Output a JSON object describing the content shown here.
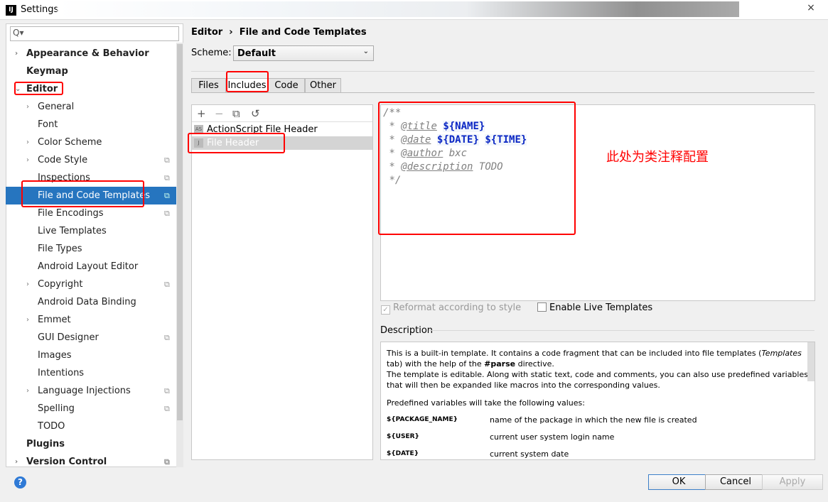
{
  "window": {
    "title": "Settings",
    "close_icon": "×"
  },
  "search": {
    "placeholder": "",
    "icon": "Q▾"
  },
  "sidebar": {
    "items": [
      {
        "label": "Appearance & Behavior",
        "level": 0,
        "bold": true,
        "arrow": "›"
      },
      {
        "label": "Keymap",
        "level": 0,
        "bold": true
      },
      {
        "label": "Editor",
        "level": 0,
        "bold": true,
        "arrow": "⌄"
      },
      {
        "label": "General",
        "level": 1,
        "arrow": "›"
      },
      {
        "label": "Font",
        "level": 1
      },
      {
        "label": "Color Scheme",
        "level": 1,
        "arrow": "›"
      },
      {
        "label": "Code Style",
        "level": 1,
        "arrow": "›",
        "copy": true
      },
      {
        "label": "Inspections",
        "level": 1,
        "copy": true
      },
      {
        "label": "File and Code Templates",
        "level": 1,
        "copy": true,
        "selected": true
      },
      {
        "label": "File Encodings",
        "level": 1,
        "copy": true
      },
      {
        "label": "Live Templates",
        "level": 1
      },
      {
        "label": "File Types",
        "level": 1
      },
      {
        "label": "Android Layout Editor",
        "level": 1
      },
      {
        "label": "Copyright",
        "level": 1,
        "arrow": "›",
        "copy": true
      },
      {
        "label": "Android Data Binding",
        "level": 1
      },
      {
        "label": "Emmet",
        "level": 1,
        "arrow": "›"
      },
      {
        "label": "GUI Designer",
        "level": 1,
        "copy": true
      },
      {
        "label": "Images",
        "level": 1
      },
      {
        "label": "Intentions",
        "level": 1
      },
      {
        "label": "Language Injections",
        "level": 1,
        "arrow": "›",
        "copy": true
      },
      {
        "label": "Spelling",
        "level": 1,
        "copy": true
      },
      {
        "label": "TODO",
        "level": 1
      },
      {
        "label": "Plugins",
        "level": 0,
        "bold": true
      },
      {
        "label": "Version Control",
        "level": 0,
        "bold": true,
        "arrow": "›",
        "copy": true
      }
    ]
  },
  "breadcrumb": {
    "parent": "Editor",
    "sep": "›",
    "current": "File and Code Templates"
  },
  "scheme": {
    "label": "Scheme:",
    "value": "Default"
  },
  "tabs": [
    "Files",
    "Includes",
    "Code",
    "Other"
  ],
  "active_tab": "Includes",
  "toolbar": {
    "add": "+",
    "remove": "−",
    "copy": "⧉",
    "reset": "↺"
  },
  "templates": [
    "ActionScript File Header",
    "File Header"
  ],
  "selected_template": "File Header",
  "editor": {
    "line1": "/**",
    "title_tag": "@title",
    "name_var": "${NAME}",
    "date_tag": "@date",
    "date_var": "${DATE}",
    "time_var": "${TIME}",
    "author_tag": "@author",
    "author": "bxc",
    "desc_tag": "@description",
    "desc": "TODO",
    "end": "*/"
  },
  "annotation": "此处为类注释配置",
  "options": {
    "reformat": "Reformat according to style",
    "reformat_checked": true,
    "live": "Enable Live Templates",
    "live_checked": false
  },
  "description": {
    "label": "Description",
    "p1a": "This is a built-in template. It contains a code fragment that can be included into file templates (",
    "p1b": "Templates",
    "p1c": " tab) with the help of the ",
    "p1d": "#parse",
    "p1e": " directive.",
    "p2": "The template is editable. Along with static text, code and comments, you can also use predefined variables that will then be expanded like macros into the corresponding values.",
    "p3": "Predefined variables will take the following values:",
    "vars": [
      {
        "name": "${PACKAGE_NAME}",
        "desc": "name of the package in which the new file is created"
      },
      {
        "name": "${USER}",
        "desc": "current user system login name"
      },
      {
        "name": "${DATE}",
        "desc": "current system date"
      }
    ]
  },
  "buttons": {
    "ok": "OK",
    "cancel": "Cancel",
    "apply": "Apply",
    "help": "?"
  },
  "colors": {
    "selection": "#2675bf",
    "annotation": "#ff0000",
    "variable": "#0b27c4"
  }
}
